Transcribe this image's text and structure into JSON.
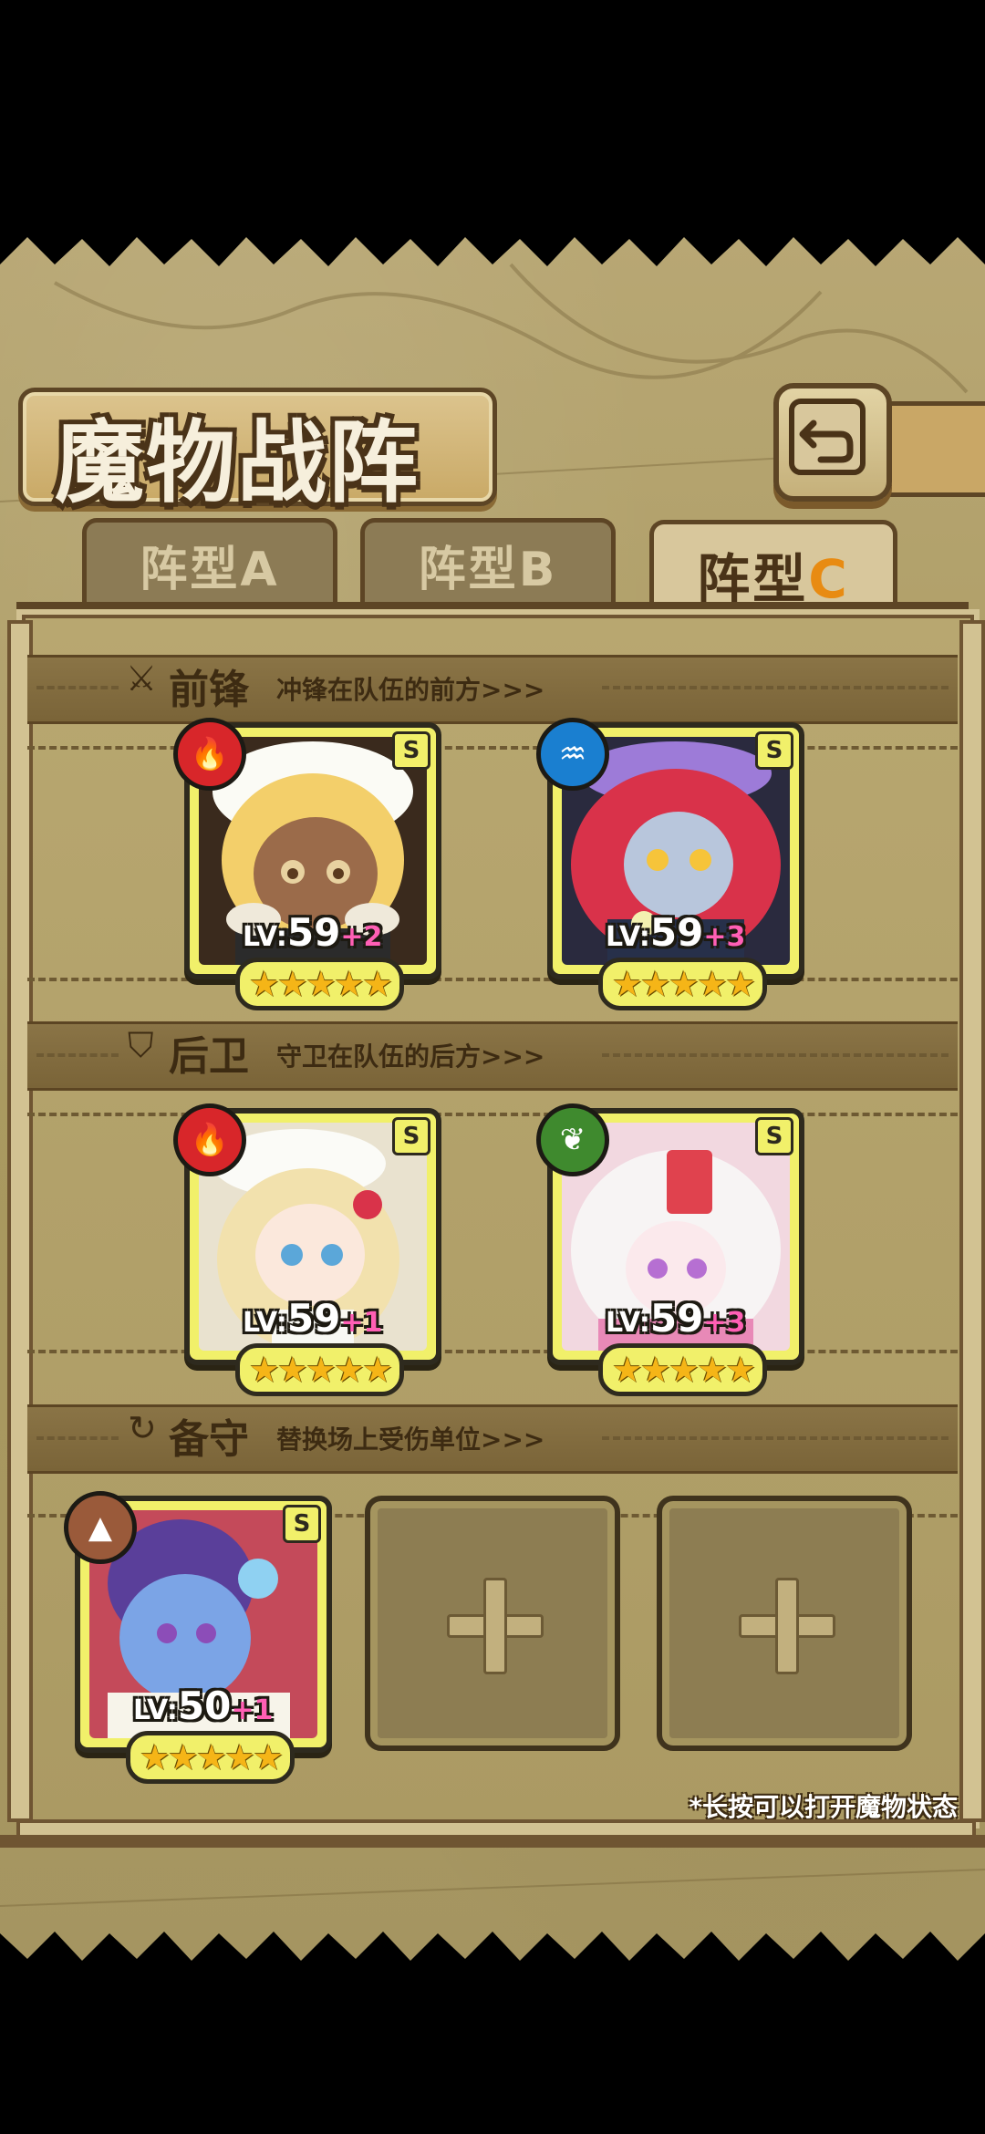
{
  "title": "魔物战阵",
  "tabs": [
    {
      "label": "阵型",
      "letter": "A",
      "active": false
    },
    {
      "label": "阵型",
      "letter": "B",
      "active": false
    },
    {
      "label": "阵型",
      "letter": "C",
      "active": true
    }
  ],
  "sections": {
    "front": {
      "title": "前锋",
      "desc": "冲锋在队伍的前方>>>"
    },
    "rear": {
      "title": "后卫",
      "desc": "守卫在队伍的后方>>>"
    },
    "reserve": {
      "title": "备守",
      "desc": "替换场上受伤单位>>>"
    }
  },
  "units": [
    {
      "lv_prefix": "LV:",
      "lv": "59",
      "plus": "+2",
      "rank": "S",
      "element": "fire",
      "element_color": "#d8262a",
      "stars": "★★★★★"
    },
    {
      "lv_prefix": "LV:",
      "lv": "59",
      "plus": "+3",
      "rank": "S",
      "element": "water",
      "element_color": "#1a7fd0",
      "stars": "★★★★★"
    },
    {
      "lv_prefix": "LV:",
      "lv": "59",
      "plus": "+1",
      "rank": "S",
      "element": "fire",
      "element_color": "#d8262a",
      "stars": "★★★★★"
    },
    {
      "lv_prefix": "LV:",
      "lv": "59",
      "plus": "+3",
      "rank": "S",
      "element": "wind",
      "element_color": "#3f8a2e",
      "stars": "★★★★★"
    },
    {
      "lv_prefix": "LV:",
      "lv": "50",
      "plus": "+1",
      "rank": "S",
      "element": "earth",
      "element_color": "#9a5a3a",
      "stars": "★★★★★"
    }
  ],
  "hint": "*长按可以打开魔物状态"
}
